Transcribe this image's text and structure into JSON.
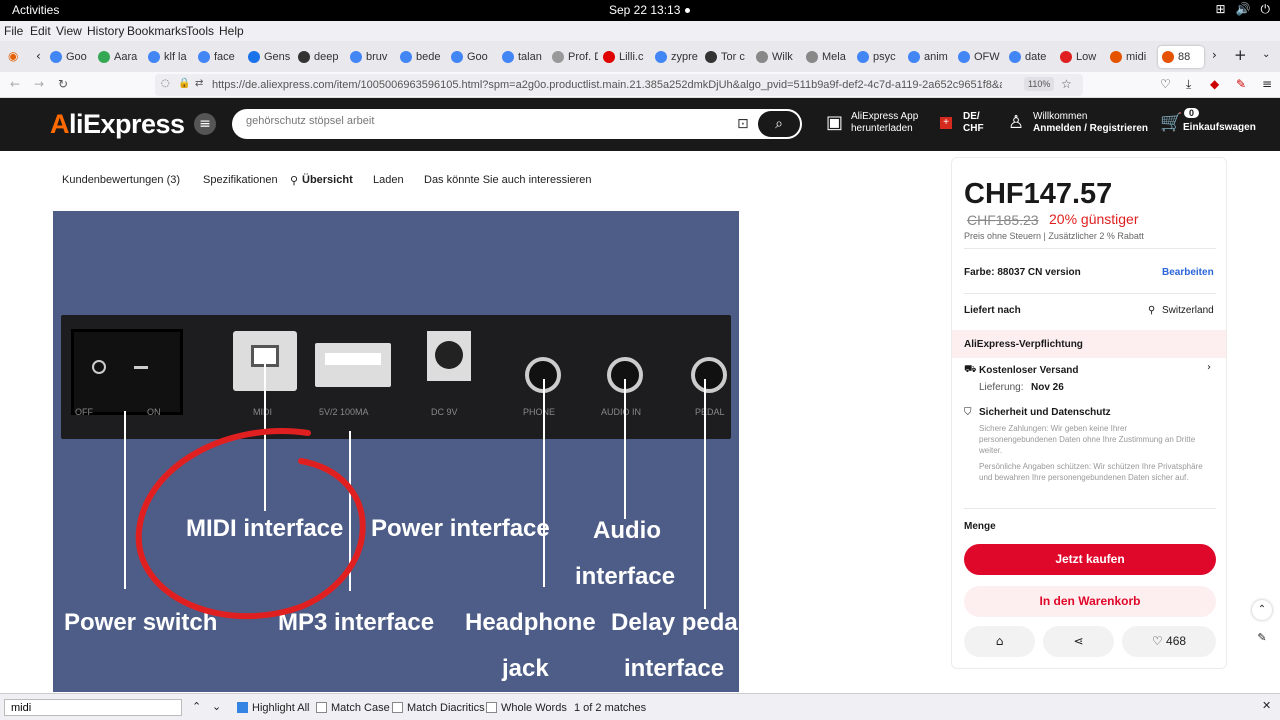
{
  "system": {
    "activities": "Activities",
    "clock": "Sep 22  13:13"
  },
  "menubar": [
    "File",
    "Edit",
    "View",
    "History",
    "Bookmarks",
    "Tools",
    "Help"
  ],
  "tabs": [
    {
      "label": "Goo",
      "color": "#4285f4"
    },
    {
      "label": "Aara",
      "color": "#34a853"
    },
    {
      "label": "klf la",
      "color": "#4285f4"
    },
    {
      "label": "face",
      "color": "#4285f4"
    },
    {
      "label": "Gens",
      "color": "#1a73e8"
    },
    {
      "label": "deep",
      "color": "#333333"
    },
    {
      "label": "bruv",
      "color": "#4285f4"
    },
    {
      "label": "bede",
      "color": "#4285f4"
    },
    {
      "label": "Goo",
      "color": "#4285f4"
    },
    {
      "label": "talan",
      "color": "#4285f4"
    },
    {
      "label": "Prof. Dr",
      "color": "#999999"
    },
    {
      "label": "Lilli.c",
      "color": "#e00000"
    },
    {
      "label": "zypre",
      "color": "#4285f4"
    },
    {
      "label": "Tor c",
      "color": "#333333"
    },
    {
      "label": "Wilk",
      "color": "#888888"
    },
    {
      "label": "Mela",
      "color": "#888888"
    },
    {
      "label": "psyc",
      "color": "#4285f4"
    },
    {
      "label": "anim",
      "color": "#4285f4"
    },
    {
      "label": "OFW",
      "color": "#4285f4"
    },
    {
      "label": "date",
      "color": "#4285f4"
    },
    {
      "label": "Low",
      "color": "#e02020"
    },
    {
      "label": "midi",
      "color": "#e55300"
    },
    {
      "label": "88",
      "color": "#e55300"
    }
  ],
  "url": "https://de.aliexpress.com/item/1005006963596105.html?spm=a2g0o.productlist.main.21.385a252dmkDjUh&algo_pvid=511b9a9f-def2-4c7d-a119-2a652c9651f8&algo_exp_id=",
  "zoom": "110%",
  "header": {
    "logo": "AliExpress",
    "search_value": "gehörschutz stöpsel arbeit",
    "app_line1": "AliExpress App",
    "app_line2": "herunterladen",
    "region_line1": "DE/",
    "region_line2": "CHF",
    "account_line1": "Willkommen",
    "account_line2": "Anmelden / Registrieren",
    "cart_count": "0",
    "cart_label": "Einkaufswagen"
  },
  "subnav": [
    "Kundenbewertungen (3)",
    "Spezifikationen",
    "Übersicht",
    "Laden",
    "Das könnte Sie auch interessieren"
  ],
  "image_labels": {
    "midi": "MIDI interface",
    "power_if": "Power interface",
    "audio1": "Audio",
    "audio2": "interface",
    "power_switch": "Power switch",
    "mp3": "MP3 interface",
    "headphone1": "Headphone",
    "headphone2": "jack",
    "delay1": "Delay pedal",
    "delay2": "interface",
    "small_off": "OFF",
    "small_on": "ON",
    "small_midi": "MIDI",
    "small_5v": "5V/2 100MA",
    "small_dc": "DC 9V",
    "small_phone": "PHONE",
    "small_audio": "AUDIO IN",
    "small_pedal": "PEDAL"
  },
  "product": {
    "price": "CHF147.57",
    "old_price": "CHF185.23",
    "discount": "20% günstiger",
    "tax_note": "Preis ohne Steuern  |  Zusätzlicher 2 % Rabatt",
    "color_label": "Farbe: 88037 CN version",
    "edit": "Bearbeiten",
    "ship_to": "Liefert nach",
    "country": "Switzerland",
    "commitment": "AliExpress-Verpflichtung",
    "free_shipping": "Kostenloser Versand",
    "delivery_label": "Lieferung:",
    "delivery_date": "Nov 26",
    "security_title": "Sicherheit und Datenschutz",
    "security_p1": "Sichere Zahlungen: Wir geben keine Ihrer personengebundenen Daten ohne Ihre Zustimmung an Dritte weiter.",
    "security_p2": "Persönliche Angaben schützen: Wir schützen Ihre Privatsphäre und bewahren Ihre personengebundenen Daten sicher auf.",
    "quantity": "Menge",
    "buy_now": "Jetzt kaufen",
    "add_cart": "In den Warenkorb",
    "wishlist_count": "468",
    "accent": "#e0082a"
  },
  "findbar": {
    "value": "midi",
    "highlight_all": "Highlight All",
    "match_case": "Match Case",
    "match_diacritics": "Match Diacritics",
    "whole_words": "Whole Words",
    "matches": "1 of 2 matches"
  }
}
